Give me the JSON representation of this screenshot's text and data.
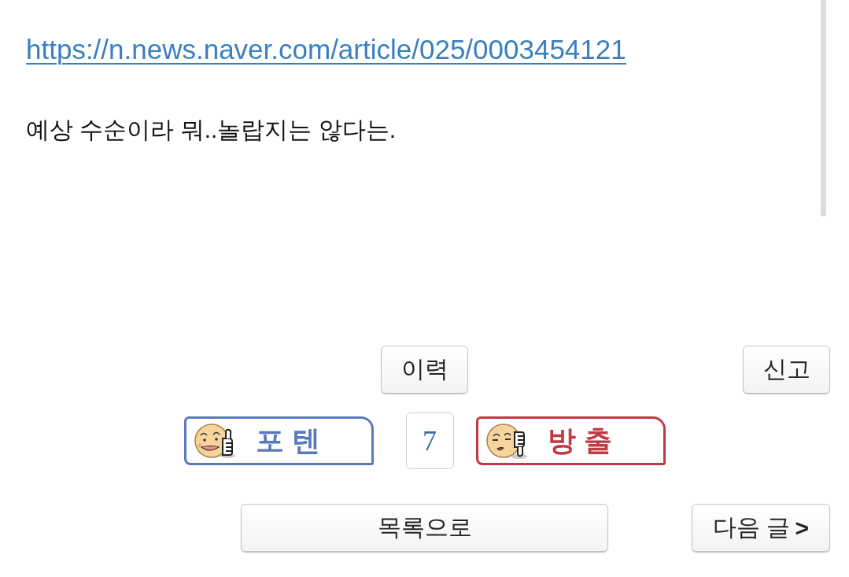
{
  "post": {
    "link": "https://n.news.naver.com/article/025/0003454121",
    "body": "예상 수순이라 뭐..놀랍지는 않다는."
  },
  "actions": {
    "history_button": "이력",
    "report_button": "신고"
  },
  "votes": [
    {
      "kind": "up",
      "label": "포텐",
      "color": "#5a79bd"
    },
    {
      "kind": "down",
      "label": "방출",
      "color": "#bf3a44"
    }
  ],
  "vote_count": "7",
  "navigation": {
    "list_button": "목록으로",
    "next_button": "다음 글 **>**"
  }
}
